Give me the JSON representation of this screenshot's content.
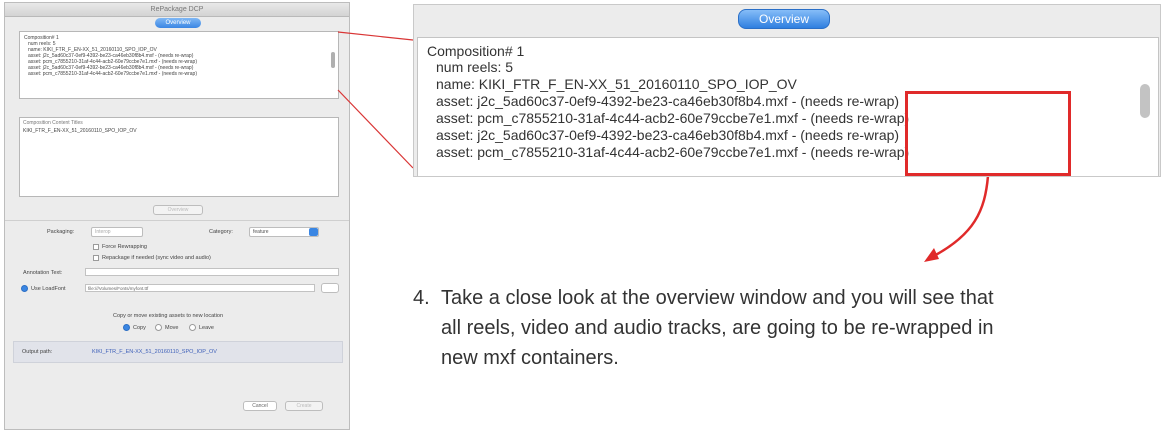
{
  "dialog": {
    "title": "RePackage DCP",
    "overview_button": "Overview",
    "overview_lines": [
      "Composition# 1",
      "num reels: 5",
      "name: KIKI_FTR_F_EN-XX_51_20160110_SPO_IOP_OV",
      "asset: j2c_5ad60c37-0ef9-4392-be23-ca46eb30f8b4.mxf - (needs re-wrap)",
      "asset: pcm_c7855210-31af-4c44-acb2-60e79ccbe7e1.mxf - (needs re-wrap)",
      "asset: j2c_5ad60c37-0ef9-4392-be23-ca46eb30f8b4.mxf - (needs re-wrap)",
      "asset: pcm_c7855210-31af-4c44-acb2-60e79ccbe7e1.mxf - (needs re-wrap)"
    ],
    "annotation_header": "Composition Content Titles",
    "annotation_value": "KIKI_FTR_F_EN-XX_51_20160110_SPO_IOP_OV",
    "overview_mid_button": "Overview",
    "packaging_label": "Packaging:",
    "packaging_value": "Interop",
    "category_label": "Category:",
    "category_value": "feature",
    "force_rewrapping": "Force Rewrapping",
    "repackage_label": "Repackage if needed (sync video and audio)",
    "annotation_text_label": "Annotation Text:",
    "use_loadfont_label": "Use LoadFont",
    "loadfont_path": "file:///Volumes/Fonts/myfont.ttf",
    "copy_move_label": "Copy or move existing assets to new location",
    "copy": "Copy",
    "move": "Move",
    "leave": "Leave",
    "output_path_label": "Output path:",
    "output_path_value": "KIKI_FTR_F_EN-XX_51_20160110_SPO_IOP_OV",
    "cancel": "Cancel",
    "create": "Create"
  },
  "zoom": {
    "overview_button": "Overview",
    "composition": "Composition# 1",
    "num_reels": "num reels:  5",
    "name": "name:  KIKI_FTR_F_EN-XX_51_20160110_SPO_IOP_OV",
    "assets": [
      "asset: j2c_5ad60c37-0ef9-4392-be23-ca46eb30f8b4.mxf - (needs re-wrap)",
      "asset: pcm_c7855210-31af-4c44-acb2-60e79ccbe7e1.mxf - (needs re-wrap)",
      "asset: j2c_5ad60c37-0ef9-4392-be23-ca46eb30f8b4.mxf - (needs re-wrap)",
      "asset: pcm_c7855210-31af-4c44-acb2-60e79ccbe7e1.mxf - (needs re-wrap)"
    ]
  },
  "step": {
    "number": "4.",
    "line1": "Take a close look at the overview window and you will see that",
    "line2": "all reels, video and audio tracks, are going to be re-wrapped in",
    "line3": "new mxf containers."
  },
  "colors": {
    "highlight": "#e02a2a",
    "accent": "#3a86e3"
  }
}
